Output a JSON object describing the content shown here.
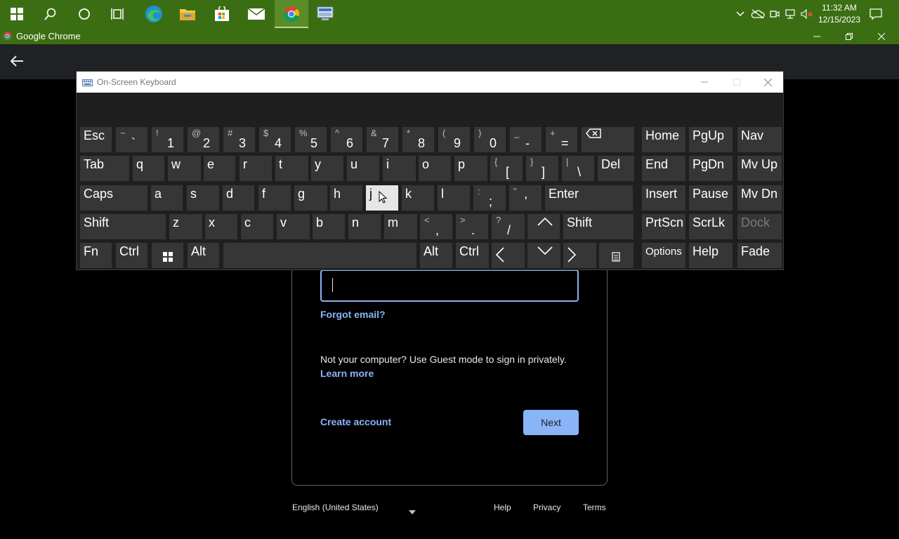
{
  "taskbar": {
    "clock_time": "11:32 AM",
    "clock_date": "12/15/2023",
    "icons": [
      "windows-start-icon",
      "search-icon",
      "cortana-icon",
      "task-view-icon",
      "edge-icon",
      "file-explorer-icon",
      "store-icon",
      "mail-icon",
      "chrome-icon",
      "network-app-icon"
    ]
  },
  "chrome": {
    "title": "Google Chrome"
  },
  "osk": {
    "title": "On-Screen Keyboard",
    "rows": [
      [
        {
          "label": "Esc"
        },
        {
          "sym": "~",
          "main": "`"
        },
        {
          "sym": "!",
          "main": "1"
        },
        {
          "sym": "@",
          "main": "2"
        },
        {
          "sym": "#",
          "main": "3"
        },
        {
          "sym": "$",
          "main": "4"
        },
        {
          "sym": "%",
          "main": "5"
        },
        {
          "sym": "^",
          "main": "6"
        },
        {
          "sym": "&",
          "main": "7"
        },
        {
          "sym": "*",
          "main": "8"
        },
        {
          "sym": "(",
          "main": "9"
        },
        {
          "sym": ")",
          "main": "0"
        },
        {
          "sym": "_",
          "main": "-"
        },
        {
          "sym": "+",
          "main": "="
        },
        {
          "icon": "backspace-icon"
        },
        {
          "label": "Home"
        },
        {
          "label": "PgUp"
        },
        {
          "label": "Nav"
        }
      ],
      [
        {
          "label": "Tab"
        },
        {
          "label": "q"
        },
        {
          "label": "w"
        },
        {
          "label": "e"
        },
        {
          "label": "r"
        },
        {
          "label": "t"
        },
        {
          "label": "y"
        },
        {
          "label": "u"
        },
        {
          "label": "i"
        },
        {
          "label": "o"
        },
        {
          "label": "p"
        },
        {
          "sym": "{",
          "main": "["
        },
        {
          "sym": "}",
          "main": "]"
        },
        {
          "sym": "|",
          "main": "\\"
        },
        {
          "label": "Del"
        },
        {
          "label": "End"
        },
        {
          "label": "PgDn"
        },
        {
          "label": "Mv Up"
        }
      ],
      [
        {
          "label": "Caps"
        },
        {
          "label": "a"
        },
        {
          "label": "s"
        },
        {
          "label": "d"
        },
        {
          "label": "f"
        },
        {
          "label": "g"
        },
        {
          "label": "h"
        },
        {
          "label": "j"
        },
        {
          "label": "k"
        },
        {
          "label": "l"
        },
        {
          "sym": ":",
          "main": ";"
        },
        {
          "sym": "\"",
          "main": "'"
        },
        {
          "label": "Enter"
        },
        {
          "label": "Insert"
        },
        {
          "label": "Pause"
        },
        {
          "label": "Mv Dn"
        }
      ],
      [
        {
          "label": "Shift"
        },
        {
          "label": "z"
        },
        {
          "label": "x"
        },
        {
          "label": "c"
        },
        {
          "label": "v"
        },
        {
          "label": "b"
        },
        {
          "label": "n"
        },
        {
          "label": "m"
        },
        {
          "sym": "<",
          "main": ","
        },
        {
          "sym": ">",
          "main": "."
        },
        {
          "sym": "?",
          "main": "/"
        },
        {
          "icon": "arrow-up-icon"
        },
        {
          "label": "Shift"
        },
        {
          "label": "PrtScn"
        },
        {
          "label": "ScrLk"
        },
        {
          "label": "Dock"
        }
      ],
      [
        {
          "label": "Fn"
        },
        {
          "label": "Ctrl"
        },
        {
          "icon": "windows-key-icon"
        },
        {
          "label": "Alt"
        },
        {
          "label": ""
        },
        {
          "label": "Alt"
        },
        {
          "label": "Ctrl"
        },
        {
          "icon": "arrow-left-icon"
        },
        {
          "icon": "arrow-down-icon"
        },
        {
          "icon": "arrow-right-icon"
        },
        {
          "icon": "menu-key-icon"
        },
        {
          "label": "Options"
        },
        {
          "label": "Help"
        },
        {
          "label": "Fade"
        }
      ]
    ]
  },
  "signin": {
    "forgot_email": "Forgot email?",
    "guest_text": "Not your computer? Use Guest mode to sign in privately.",
    "learn_more": "Learn more",
    "create_account": "Create account",
    "next": "Next"
  },
  "footer": {
    "language": "English (United States)",
    "help": "Help",
    "privacy": "Privacy",
    "terms": "Terms"
  }
}
